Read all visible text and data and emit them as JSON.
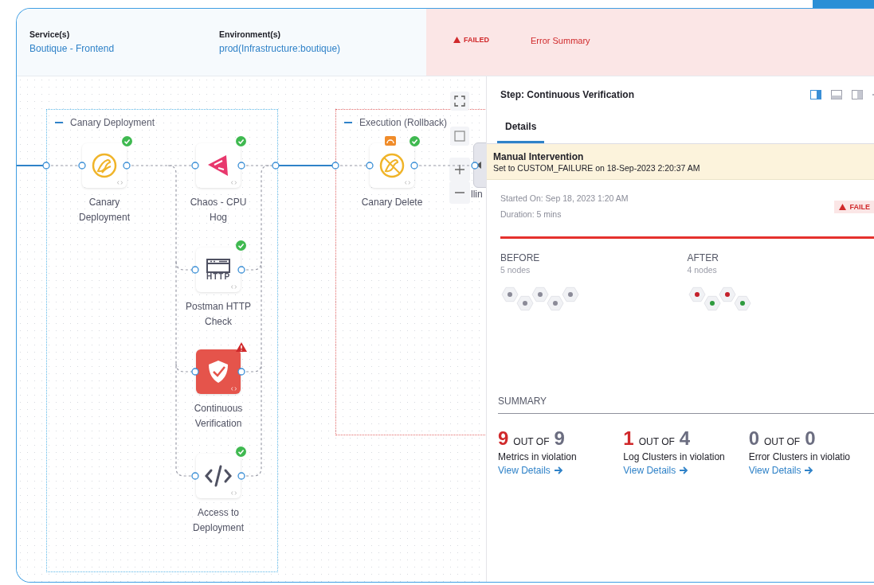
{
  "header": {
    "service": {
      "label": "Service(s)",
      "value": "Boutique - Frontend"
    },
    "environment": {
      "label": "Environment(s)",
      "value": "prod(Infrastructure:boutique)"
    },
    "status": "FAILED",
    "error_link": "Error Summary"
  },
  "canvas": {
    "groups": [
      {
        "title": "Canary Deployment",
        "kind": "stage",
        "nodes": [
          {
            "label": "Canary Deployment",
            "kind": "canary",
            "passed": true,
            "selected": false,
            "rollback": false
          },
          {
            "label": "Chaos - CPU Hog",
            "kind": "chaos",
            "passed": true,
            "selected": false,
            "rollback": false
          },
          {
            "label": "Postman HTTP Check",
            "kind": "http",
            "icon_text": "HTTP",
            "passed": true,
            "selected": false,
            "rollback": false
          },
          {
            "label": "Continuous Verification",
            "kind": "verify",
            "passed": false,
            "selected": true,
            "rollback": false
          },
          {
            "label": "Access to Deployment",
            "kind": "script",
            "passed": true,
            "selected": false,
            "rollback": false
          }
        ]
      },
      {
        "title": "Execution (Rollback)",
        "kind": "rollback",
        "nodes": [
          {
            "label": "Canary Delete",
            "kind": "canary_delete",
            "passed": true,
            "selected": false,
            "rollback": true
          }
        ]
      }
    ],
    "next_node": {
      "label": "llin"
    }
  },
  "panel": {
    "title": "Step: Continuous Verification",
    "tabs": [
      {
        "label": "Details",
        "selected": true
      }
    ],
    "banner": {
      "title": "Manual Intervention",
      "text": "Set to CUSTOM_FAILURE on 18-Sep-2023 2:20:37 AM"
    },
    "started": "Started On: Sep 18, 2023 1:20 AM",
    "duration": "Duration: 5 mins",
    "status": "FAILE",
    "before": {
      "label": "BEFORE",
      "count": "5 nodes",
      "nodes": [
        {
          "color": "#8b8b98"
        },
        {
          "color": "#8b8b98"
        },
        {
          "color": "#8b8b98"
        },
        {
          "color": "#8b8b98"
        },
        {
          "color": "#8b8b98"
        }
      ]
    },
    "after": {
      "label": "AFTER",
      "count": "4 nodes",
      "nodes": [
        {
          "color": "#c4202b"
        },
        {
          "color": "#2e9b3e"
        },
        {
          "color": "#c4202b"
        },
        {
          "color": "#2e9b3e"
        }
      ]
    },
    "summary": {
      "title": "SUMMARY",
      "stats": [
        {
          "count": "9",
          "out_of": "OUT OF",
          "total": "9",
          "violated": true,
          "label": "Metrics in violation",
          "link": "View Details"
        },
        {
          "count": "1",
          "out_of": "OUT OF",
          "total": "4",
          "violated": true,
          "label": "Log Clusters in violation",
          "link": "View Details"
        },
        {
          "count": "0",
          "out_of": "OUT OF",
          "total": "0",
          "violated": false,
          "label": "Error Clusters in violatio",
          "link": "View Details"
        }
      ]
    }
  }
}
